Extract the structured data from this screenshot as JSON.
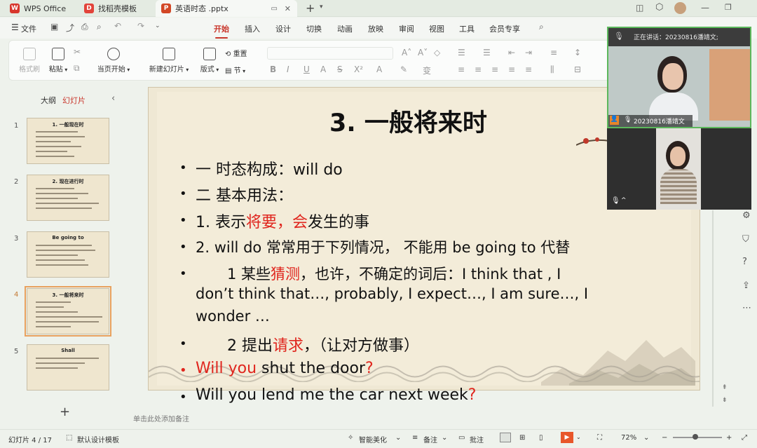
{
  "tabs": [
    {
      "label": "WPS Office",
      "logo": "W",
      "color": "#d8362c"
    },
    {
      "label": "找稻壳模板",
      "logo": "D",
      "color": "#e2433a"
    },
    {
      "label": "英语时态 .pptx",
      "logo": "P",
      "color": "#d24726"
    }
  ],
  "menubar": {
    "file": "文件",
    "items": [
      "开始",
      "插入",
      "设计",
      "切换",
      "动画",
      "放映",
      "审阅",
      "视图",
      "工具",
      "会员专享"
    ]
  },
  "ribbon": {
    "format_painter": "格式刷",
    "paste": "粘贴",
    "play_from_current": "当页开始",
    "new_slide": "新建幻灯片",
    "layout": "版式",
    "reset": "重置",
    "section": "节"
  },
  "panel": {
    "tab_outline": "大纲",
    "tab_slides": "幻灯片"
  },
  "thumbnails": [
    {
      "num": "1",
      "title": "1. 一般现在时"
    },
    {
      "num": "2",
      "title": "2. 现在进行时"
    },
    {
      "num": "3",
      "title": "Be going to"
    },
    {
      "num": "4",
      "title": "3. 一般将来时"
    },
    {
      "num": "5",
      "title": "Shall"
    }
  ],
  "slide": {
    "title": "3. 一般将来时",
    "b1": "一 时态构成：will do",
    "b2": "二 基本用法：",
    "b3a": "1. 表示",
    "b3b": "将要，会",
    "b3c": "发生的事",
    "b4": "2. will do 常常用于下列情况，  不能用 be going to 代替",
    "b5a": "1 某些",
    "b5b": "猜测",
    "b5c": "，也许，不确定的词后：I think that     , I",
    "b5line2": "don’t think that…, probably, I expect…, I am sure…, I",
    "b5line3": "wonder …",
    "b6a": "2 提出",
    "b6b": "请求",
    "b6c": "，（让对方做事）",
    "b7a": "Will you",
    "b7b": " shut the door",
    "b7c": "?",
    "b8a": "Will you lend me the car next week",
    "b8b": "?"
  },
  "notes_placeholder": "单击此处添加备注",
  "video": {
    "speaking": "正在讲话：20230816潘靖文;",
    "name": "20230816潘靖文",
    "bottom_label": "^"
  },
  "status": {
    "slide_counter": "幻灯片 4 / 17",
    "template": "默认设计模板",
    "beautify": "智能美化",
    "notes": "备注",
    "comments": "批注",
    "zoom": "72%"
  }
}
